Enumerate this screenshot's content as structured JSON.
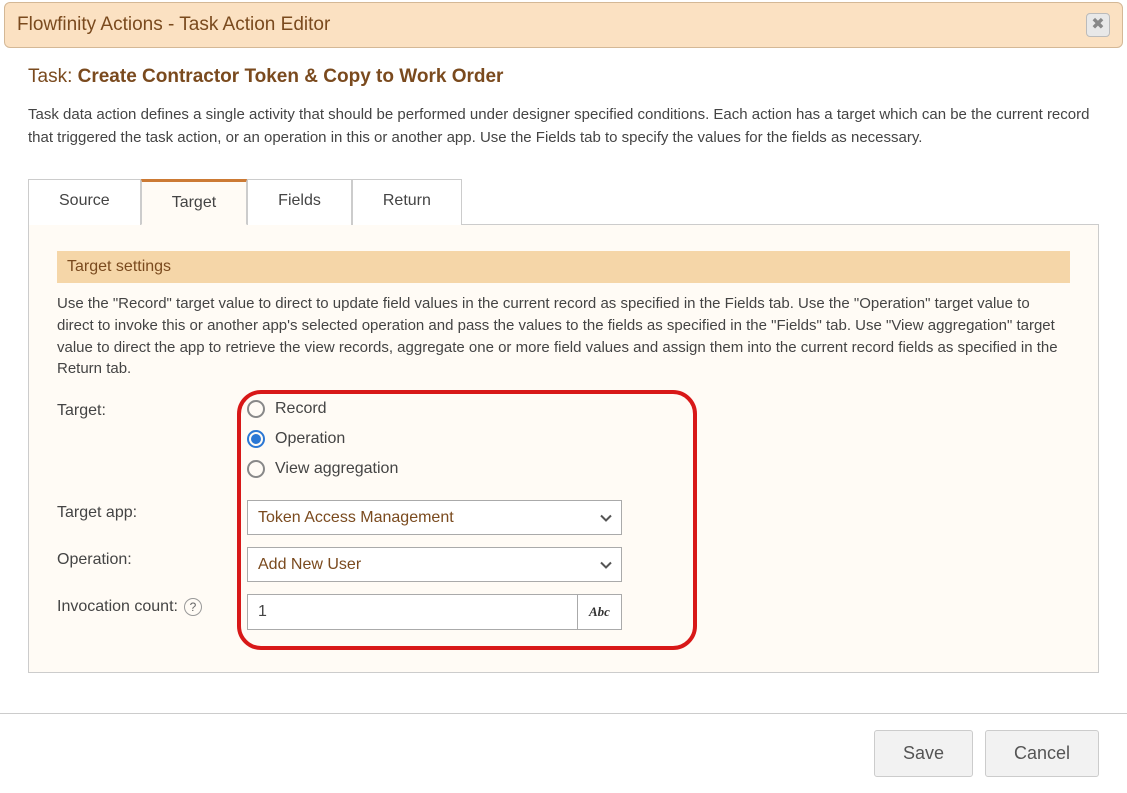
{
  "dialog": {
    "title": "Flowfinity Actions - Task Action Editor"
  },
  "task": {
    "prefix": "Task: ",
    "name": "Create Contractor Token & Copy to Work Order"
  },
  "description": "Task data action defines a single activity that should be performed under designer specified conditions. Each action has a target which can be the current record that triggered the task action, or an operation in this or another app. Use the Fields tab to specify the values for the fields as necessary.",
  "tabs": {
    "source": "Source",
    "target": "Target",
    "fields": "Fields",
    "return": "Return"
  },
  "section": {
    "header": "Target settings",
    "desc": "Use the \"Record\" target value to direct to update field values in the current record as specified in the Fields tab. Use the \"Operation\" target value to direct to invoke this or another app's selected operation and pass the values to the fields as specified in the \"Fields\" tab. Use \"View aggregation\" target value to direct the app to retrieve the view records, aggregate one or more field values and assign them into the current record fields as specified in the Return tab."
  },
  "form": {
    "target_label": "Target:",
    "target_options": {
      "record": "Record",
      "operation": "Operation",
      "view_agg": "View aggregation"
    },
    "target_app_label": "Target app:",
    "target_app_value": "Token Access Management",
    "operation_label": "Operation:",
    "operation_value": "Add New User",
    "invocation_label": "Invocation count:",
    "invocation_value": "1",
    "abc_label": "Abc"
  },
  "footer": {
    "save": "Save",
    "cancel": "Cancel"
  }
}
